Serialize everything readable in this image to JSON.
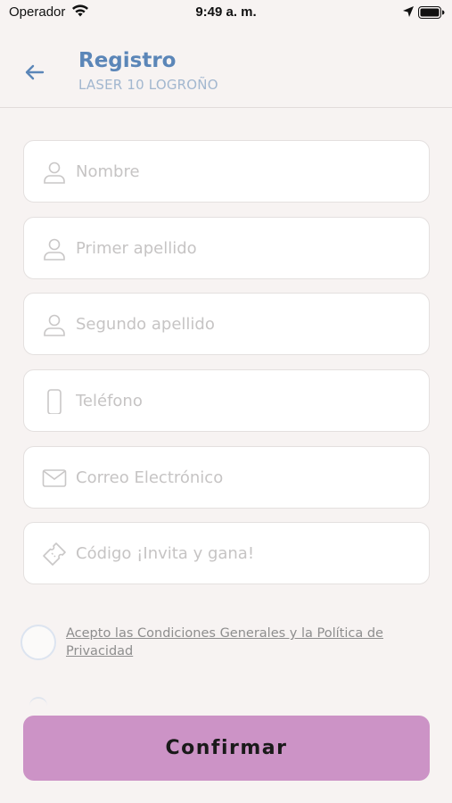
{
  "status_bar": {
    "carrier": "Operador",
    "time": "9:49 a. m."
  },
  "header": {
    "title": "Registro",
    "subtitle": "LASER 10 LOGROÑO",
    "back_icon": "arrow-left-icon"
  },
  "form": {
    "fields": [
      {
        "placeholder": "Nombre",
        "icon": "user-icon"
      },
      {
        "placeholder": "Primer apellido",
        "icon": "user-icon"
      },
      {
        "placeholder": "Segundo apellido",
        "icon": "user-icon"
      },
      {
        "placeholder": "Teléfono",
        "icon": "phone-icon"
      },
      {
        "placeholder": "Correo Electrónico",
        "icon": "mail-icon"
      },
      {
        "placeholder": "Código ¡Invita y gana!",
        "icon": "ticket-icon"
      }
    ]
  },
  "terms": {
    "label": "Acepto las Condiciones Generales y la Política de Privacidad",
    "checked": false
  },
  "confirm_label": "Confirmar",
  "colors": {
    "background": "#f7f3f2",
    "title": "#5b86b8",
    "subtitle": "#a2b7cf",
    "button": "#cc93c6"
  }
}
